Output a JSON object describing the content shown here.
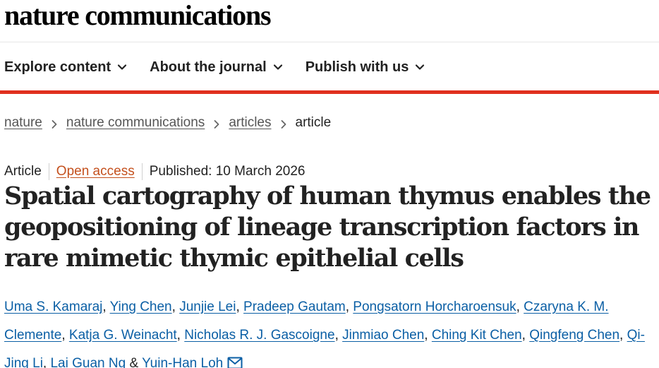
{
  "header": {
    "brand": "nature communications"
  },
  "nav": {
    "items": [
      {
        "label": "Explore content"
      },
      {
        "label": "About the journal"
      },
      {
        "label": "Publish with us"
      }
    ]
  },
  "breadcrumb": {
    "items": [
      "nature",
      "nature communications",
      "articles"
    ],
    "current": "article"
  },
  "meta": {
    "type": "Article",
    "access": "Open access",
    "published": "Published: 10 March 2026"
  },
  "article": {
    "title": "Spatial cartography of human thymus enables the geopositioning of lineage transcription factors in rare mimetic thymic epithelial cells"
  },
  "authors": {
    "list": [
      "Uma S. Kamaraj",
      "Ying Chen",
      "Junjie Lei",
      "Pradeep Gautam",
      "Pongsatorn Horcharoensuk",
      "Czaryna K. M. Clemente",
      "Katja G. Weinacht",
      "Nicholas R. J. Gascoigne",
      "Jinmiao Chen",
      "Ching Kit Chen",
      "Qingfeng Chen",
      "Qi-Jing Li",
      "Lai Guan Ng",
      "Yuin-Han Loh"
    ],
    "separator": ", ",
    "last_separator": " & ",
    "contact_icon": "mail-icon"
  },
  "colors": {
    "accent_red": "#e0301e",
    "link_blue": "#0b5fa5",
    "open_access_orange": "#c4501d"
  }
}
